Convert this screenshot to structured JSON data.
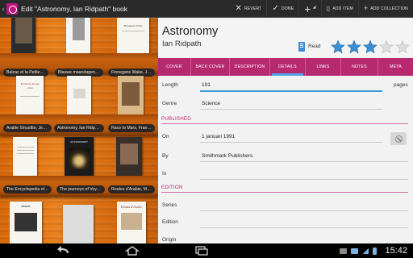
{
  "actionbar": {
    "title": "Edit \"Astronomy, Ian Ridpath\" book",
    "actions": [
      {
        "label": "REVERT",
        "icon": "revert-icon"
      },
      {
        "label": "DONE",
        "icon": "check-icon"
      },
      {
        "label": "",
        "icon": "add-plus-icon"
      },
      {
        "label": "ADD ITEM",
        "icon": "add-item-icon"
      },
      {
        "label": "ADD COLLECTION",
        "icon": "add-collection-icon"
      }
    ]
  },
  "shelf": {
    "rows": [
      {
        "labels": [
          "Balzac et la Petite T...",
          "Blauwe maandagen...",
          "Finnegans Wake, Ja..."
        ],
        "covers": [
          "",
          "",
          "Finnegans Wake"
        ]
      },
      {
        "labels": [
          "Arable Sécudite, Jea...",
          "Astronomy, Ian Ridpat...",
          "Race to Mars, Frank..."
        ],
        "covers": [
          "Ecritures du sud arabe",
          "",
          ""
        ]
      },
      {
        "labels": [
          "The Encyclopedia of...",
          "The journeys of Voy...",
          "Routes d'Arabie, Mus..."
        ],
        "covers": [
          "",
          "ASTRONOMY",
          ""
        ]
      },
      {
        "labels": [
          "",
          "",
          ""
        ],
        "covers": [
          "SPACE",
          "",
          "Routes d'Arabie"
        ]
      }
    ]
  },
  "details": {
    "title": "Astronomy",
    "author": "Ian Ridpath",
    "read_label": "Read",
    "rating": 3,
    "rating_max": 5,
    "tabs": [
      "COVER",
      "BACK COVER",
      "DESCRIPTION",
      "DETAILS",
      "LINKS",
      "NOTES",
      "META"
    ],
    "active_tab": "DETAILS",
    "fields": {
      "length_label": "Length",
      "length_value": "191",
      "length_suffix": "pages",
      "genre_label": "Genre",
      "genre_value": "Science",
      "published_section": "PUBLISHED",
      "on_label": "On",
      "on_value": "1 januari 1991",
      "by_label": "By",
      "by_value": "Smithmark Publishers",
      "in_label": "In",
      "edition_section": "EDITION",
      "series_label": "Series",
      "edition_label": "Edition",
      "origin_label": "Origin"
    }
  },
  "status": {
    "time": "15:42"
  },
  "colors": {
    "accent": "#b72a70",
    "focus": "#3d9bd9",
    "star": "#3b8ed4",
    "shelf": "#e07616"
  }
}
